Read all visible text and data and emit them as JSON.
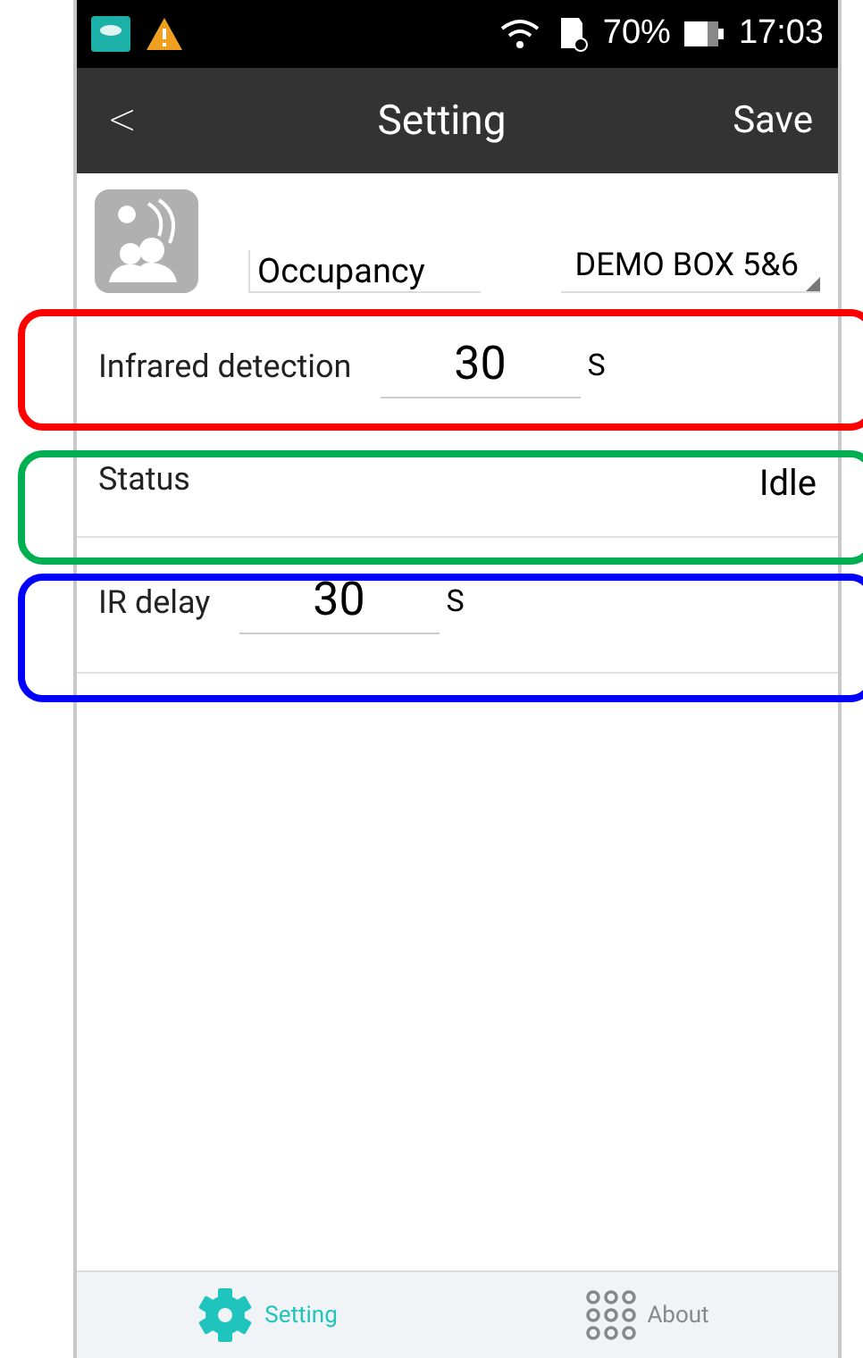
{
  "status_bar": {
    "battery": "70%",
    "time": "17:03"
  },
  "header": {
    "back": "<",
    "title": "Setting",
    "action": "Save"
  },
  "device": {
    "type": "Occupancy",
    "name": "DEMO BOX 5&6"
  },
  "settings": [
    {
      "kind": "input",
      "label": "Infrared detection",
      "value": "30",
      "unit": "S"
    },
    {
      "kind": "status",
      "label": "Status",
      "value": "Idle"
    },
    {
      "kind": "input",
      "label": "IR delay",
      "value": "30",
      "unit": "S"
    }
  ],
  "highlights": [
    {
      "color": "#ff0000"
    },
    {
      "color": "#00b050"
    },
    {
      "color": "#0000ff"
    }
  ],
  "nav": [
    {
      "label": "Setting",
      "selected": true
    },
    {
      "label": "About",
      "selected": false
    }
  ]
}
